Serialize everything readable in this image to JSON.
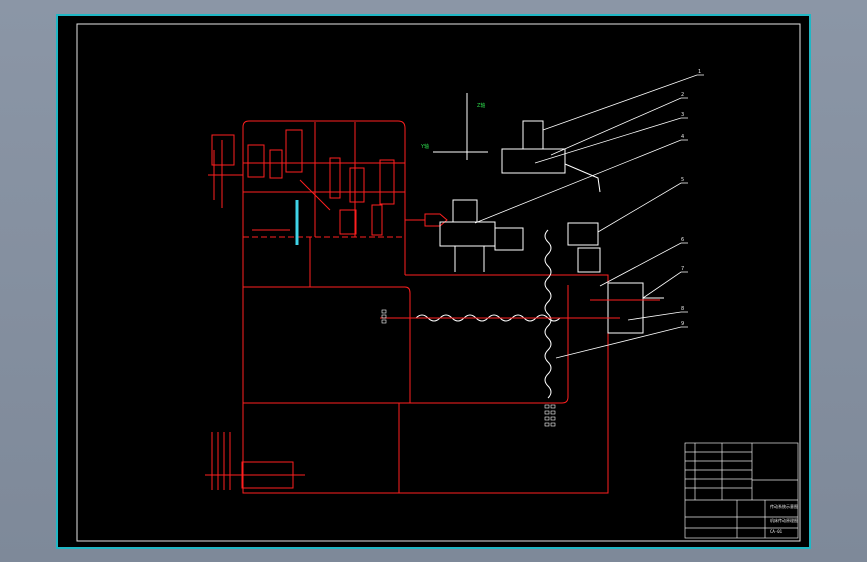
{
  "colors": {
    "background": "#000000",
    "frame_outer": "#20b7c5",
    "frame_inner": "#ffffff",
    "lines": "#ff1f1f",
    "cyan": "#3fd4e8",
    "green": "#2bd64a",
    "white": "#ffffff",
    "chrome": "#8b96a6"
  },
  "drawing": {
    "axis_labels": {
      "vertical": "Z轴",
      "horizontal": "Y轴"
    },
    "leader_numbers": [
      "1",
      "2",
      "3",
      "4",
      "5",
      "6",
      "7",
      "8",
      "9"
    ],
    "title_block": {
      "title": "传动系统示意图",
      "subtitle": "机床传动原理图",
      "drawing_no": "CA-01"
    }
  }
}
